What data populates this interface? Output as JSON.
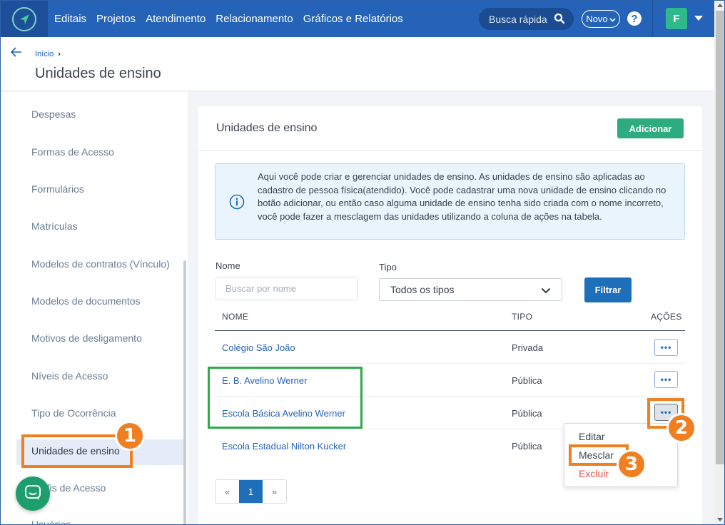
{
  "topbar": {
    "nav": [
      "Editais",
      "Projetos",
      "Atendimento",
      "Relacionamento",
      "Gráficos e Relatórios"
    ],
    "search_label": "Busca rápida",
    "novo_label": "Novo",
    "help_label": "?",
    "avatar_initial": "F"
  },
  "header": {
    "breadcrumb_home": "Início",
    "breadcrumb_sep": "›",
    "title": "Unidades de ensino"
  },
  "sidebar": {
    "items": [
      {
        "label": "Despesas"
      },
      {
        "label": "Formas de Acesso"
      },
      {
        "label": "Formulários"
      },
      {
        "label": "Matrículas"
      },
      {
        "label": "Modelos de contratos (Vínculo)"
      },
      {
        "label": "Modelos de documentos"
      },
      {
        "label": "Motivos de desligamento"
      },
      {
        "label": "Níveis de Acesso"
      },
      {
        "label": "Tipo de Ocorrência"
      },
      {
        "label": "Unidades de ensino"
      },
      {
        "label": "Perfis de Acesso"
      },
      {
        "label": "Usuários"
      }
    ],
    "active_index": 9
  },
  "card": {
    "title": "Unidades de ensino",
    "add_label": "Adicionar",
    "info_text": "Aqui você pode criar e gerenciar unidades de ensino. As unidades de ensino são aplicadas ao cadastro de pessoa física(atendido). Você pode cadastrar uma nova unidade de ensino clicando no botão adicionar, ou então caso alguma unidade de ensino tenha sido criada com o nome incorreto, você pode fazer a mesclagem das unidades utilizando a coluna de ações na tabela."
  },
  "filters": {
    "name_label": "Nome",
    "name_placeholder": "Buscar por nome",
    "type_label": "Tipo",
    "type_value": "Todos os tipos",
    "filter_label": "Filtrar"
  },
  "table": {
    "headers": {
      "name": "NOME",
      "type": "TIPO",
      "actions": "AÇÕES"
    },
    "rows": [
      {
        "name": "Colégio São João",
        "type": "Privada"
      },
      {
        "name": "E. B. Avelino Werner",
        "type": "Pública"
      },
      {
        "name": "Escola Básica Avelino Werner",
        "type": "Pública"
      },
      {
        "name": "Escola Estadual Nilton Kucker",
        "type": "Pública"
      }
    ],
    "action_label": "•••"
  },
  "dropdown": {
    "edit": "Editar",
    "merge": "Mesclar",
    "delete": "Excluir"
  },
  "pagination": {
    "prev": "«",
    "current": "1",
    "next": "»"
  },
  "annotations": {
    "step1": "1",
    "step2": "2",
    "step3": "3"
  },
  "colors": {
    "primary": "#2563b9",
    "success": "#2eab7f",
    "danger": "#e0534f",
    "annotation_orange": "#f07f22",
    "annotation_green": "#2dab4a"
  }
}
